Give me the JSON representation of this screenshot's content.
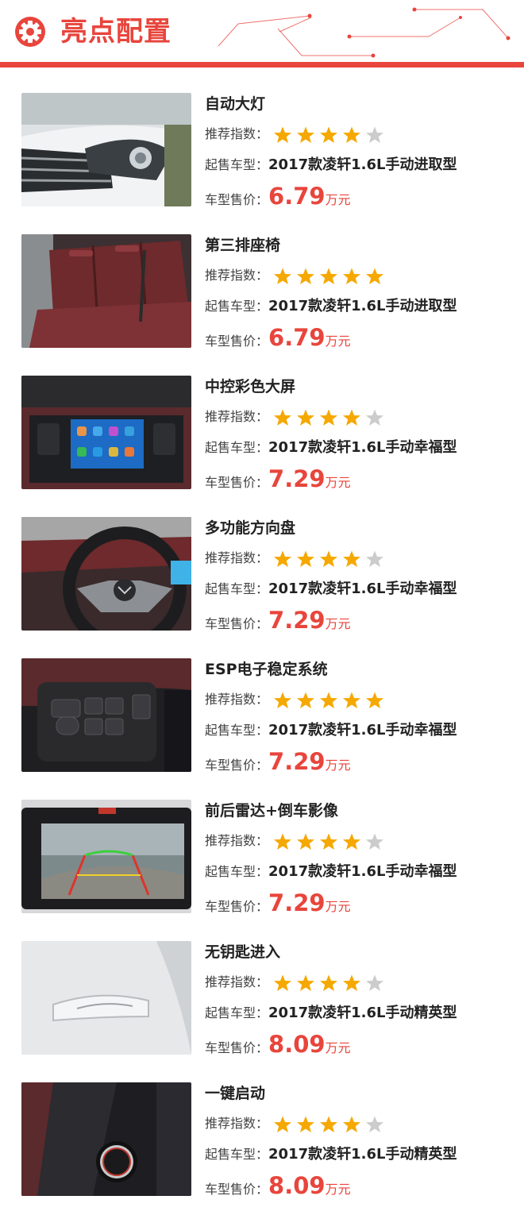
{
  "header": {
    "title": "亮点配置"
  },
  "labels": {
    "rating": "推荐指数：",
    "model": "起售车型：",
    "price": "车型售价：",
    "unit": "万元"
  },
  "colors": {
    "accent": "#e8453c",
    "star_on": "#f5a800",
    "star_off": "#cccccc"
  },
  "items": [
    {
      "feature": "自动大灯",
      "stars": 4,
      "model": "2017款凌轩1.6L手动进取型",
      "price": "6.79",
      "image": "headlight"
    },
    {
      "feature": "第三排座椅",
      "stars": 5,
      "model": "2017款凌轩1.6L手动进取型",
      "price": "6.79",
      "image": "seats"
    },
    {
      "feature": "中控彩色大屏",
      "stars": 4,
      "model": "2017款凌轩1.6L手动幸福型",
      "price": "7.29",
      "image": "screen"
    },
    {
      "feature": "多功能方向盘",
      "stars": 4,
      "model": "2017款凌轩1.6L手动幸福型",
      "price": "7.29",
      "image": "steering"
    },
    {
      "feature": "ESP电子稳定系统",
      "stars": 5,
      "model": "2017款凌轩1.6L手动幸福型",
      "price": "7.29",
      "image": "esp"
    },
    {
      "feature": "前后雷达+倒车影像",
      "stars": 4,
      "model": "2017款凌轩1.6L手动幸福型",
      "price": "7.29",
      "image": "camera"
    },
    {
      "feature": "无钥匙进入",
      "stars": 4,
      "model": "2017款凌轩1.6L手动精英型",
      "price": "8.09",
      "image": "handle"
    },
    {
      "feature": "一键启动",
      "stars": 4,
      "model": "2017款凌轩1.6L手动精英型",
      "price": "8.09",
      "image": "start"
    }
  ]
}
